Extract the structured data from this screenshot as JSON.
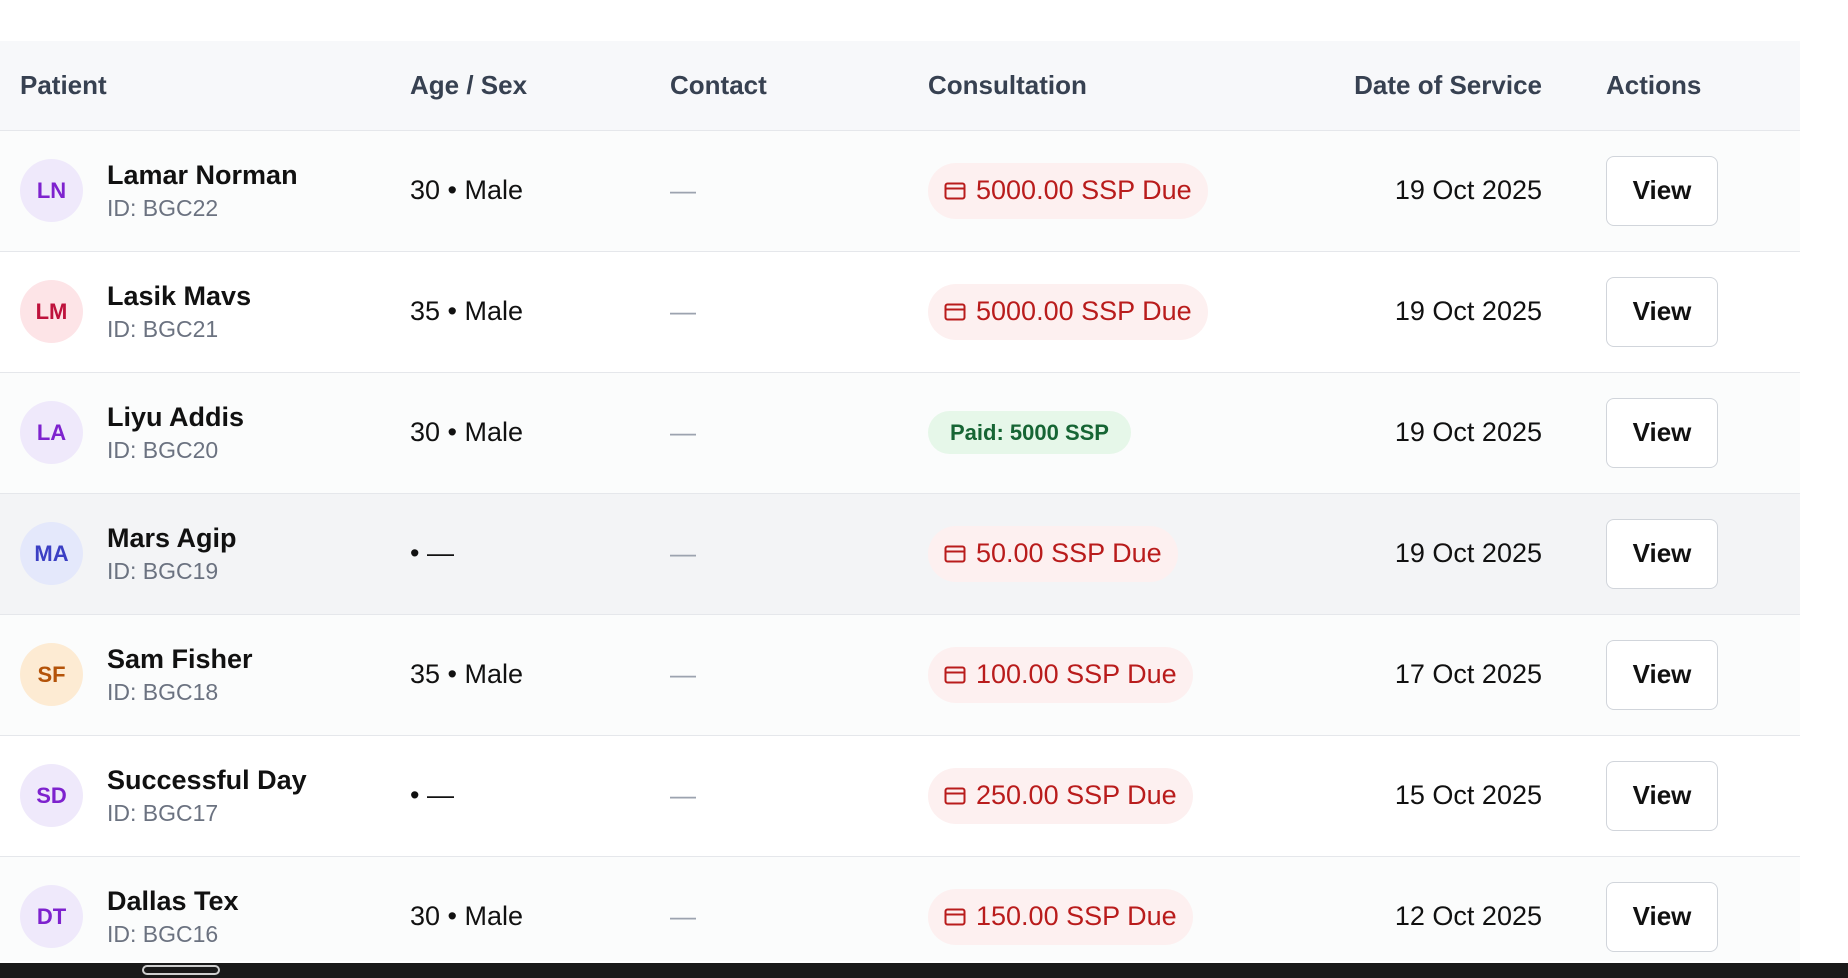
{
  "columns": {
    "patient": "Patient",
    "age_sex": "Age / Sex",
    "contact": "Contact",
    "consultation": "Consultation",
    "date": "Date of Service",
    "actions": "Actions"
  },
  "rows": [
    {
      "initials": "LN",
      "avatar_bg": "#efe9fb",
      "avatar_fg": "#7e22ce",
      "name": "Lamar Norman",
      "id": "ID: BGC22",
      "age_sex": "30 • Male",
      "contact": "—",
      "status": "due",
      "consultation": "5000.00 SSP Due",
      "date": "19 Oct 2025",
      "action": "View"
    },
    {
      "initials": "LM",
      "avatar_bg": "#fde4e7",
      "avatar_fg": "#be123c",
      "name": "Lasik Mavs",
      "id": "ID: BGC21",
      "age_sex": "35 • Male",
      "contact": "—",
      "status": "due",
      "consultation": "5000.00 SSP Due",
      "date": "19 Oct 2025",
      "action": "View"
    },
    {
      "initials": "LA",
      "avatar_bg": "#efe9fb",
      "avatar_fg": "#7e22ce",
      "name": "Liyu Addis",
      "id": "ID: BGC20",
      "age_sex": "30 • Male",
      "contact": "—",
      "status": "paid",
      "consultation": "Paid: 5000 SSP",
      "date": "19 Oct 2025",
      "action": "View"
    },
    {
      "initials": "MA",
      "avatar_bg": "#e4e8fb",
      "avatar_fg": "#3b3fc4",
      "name": "Mars Agip",
      "id": "ID: BGC19",
      "age_sex": "• —",
      "contact": "—",
      "status": "due",
      "consultation": "50.00 SSP Due",
      "date": "19 Oct 2025",
      "action": "View"
    },
    {
      "initials": "SF",
      "avatar_bg": "#fdebd3",
      "avatar_fg": "#b45309",
      "name": "Sam Fisher",
      "id": "ID: BGC18",
      "age_sex": "35 • Male",
      "contact": "—",
      "status": "due",
      "consultation": "100.00 SSP Due",
      "date": "17 Oct 2025",
      "action": "View"
    },
    {
      "initials": "SD",
      "avatar_bg": "#efe9fb",
      "avatar_fg": "#7e22ce",
      "name": "Successful Day",
      "id": "ID: BGC17",
      "age_sex": "• —",
      "contact": "—",
      "status": "due",
      "consultation": "250.00 SSP Due",
      "date": "15 Oct 2025",
      "action": "View"
    },
    {
      "initials": "DT",
      "avatar_bg": "#efe9fb",
      "avatar_fg": "#7e22ce",
      "name": "Dallas Tex",
      "id": "ID: BGC16",
      "age_sex": "30 • Male",
      "contact": "—",
      "status": "due",
      "consultation": "150.00 SSP Due",
      "date": "12 Oct 2025",
      "action": "View"
    }
  ],
  "icons": {
    "due_badge": "credit-card-icon"
  },
  "colors": {
    "due_text": "#b91c1c",
    "due_bg": "#fdf0f0",
    "paid_text": "#166534",
    "paid_bg": "#e6f7e9"
  }
}
